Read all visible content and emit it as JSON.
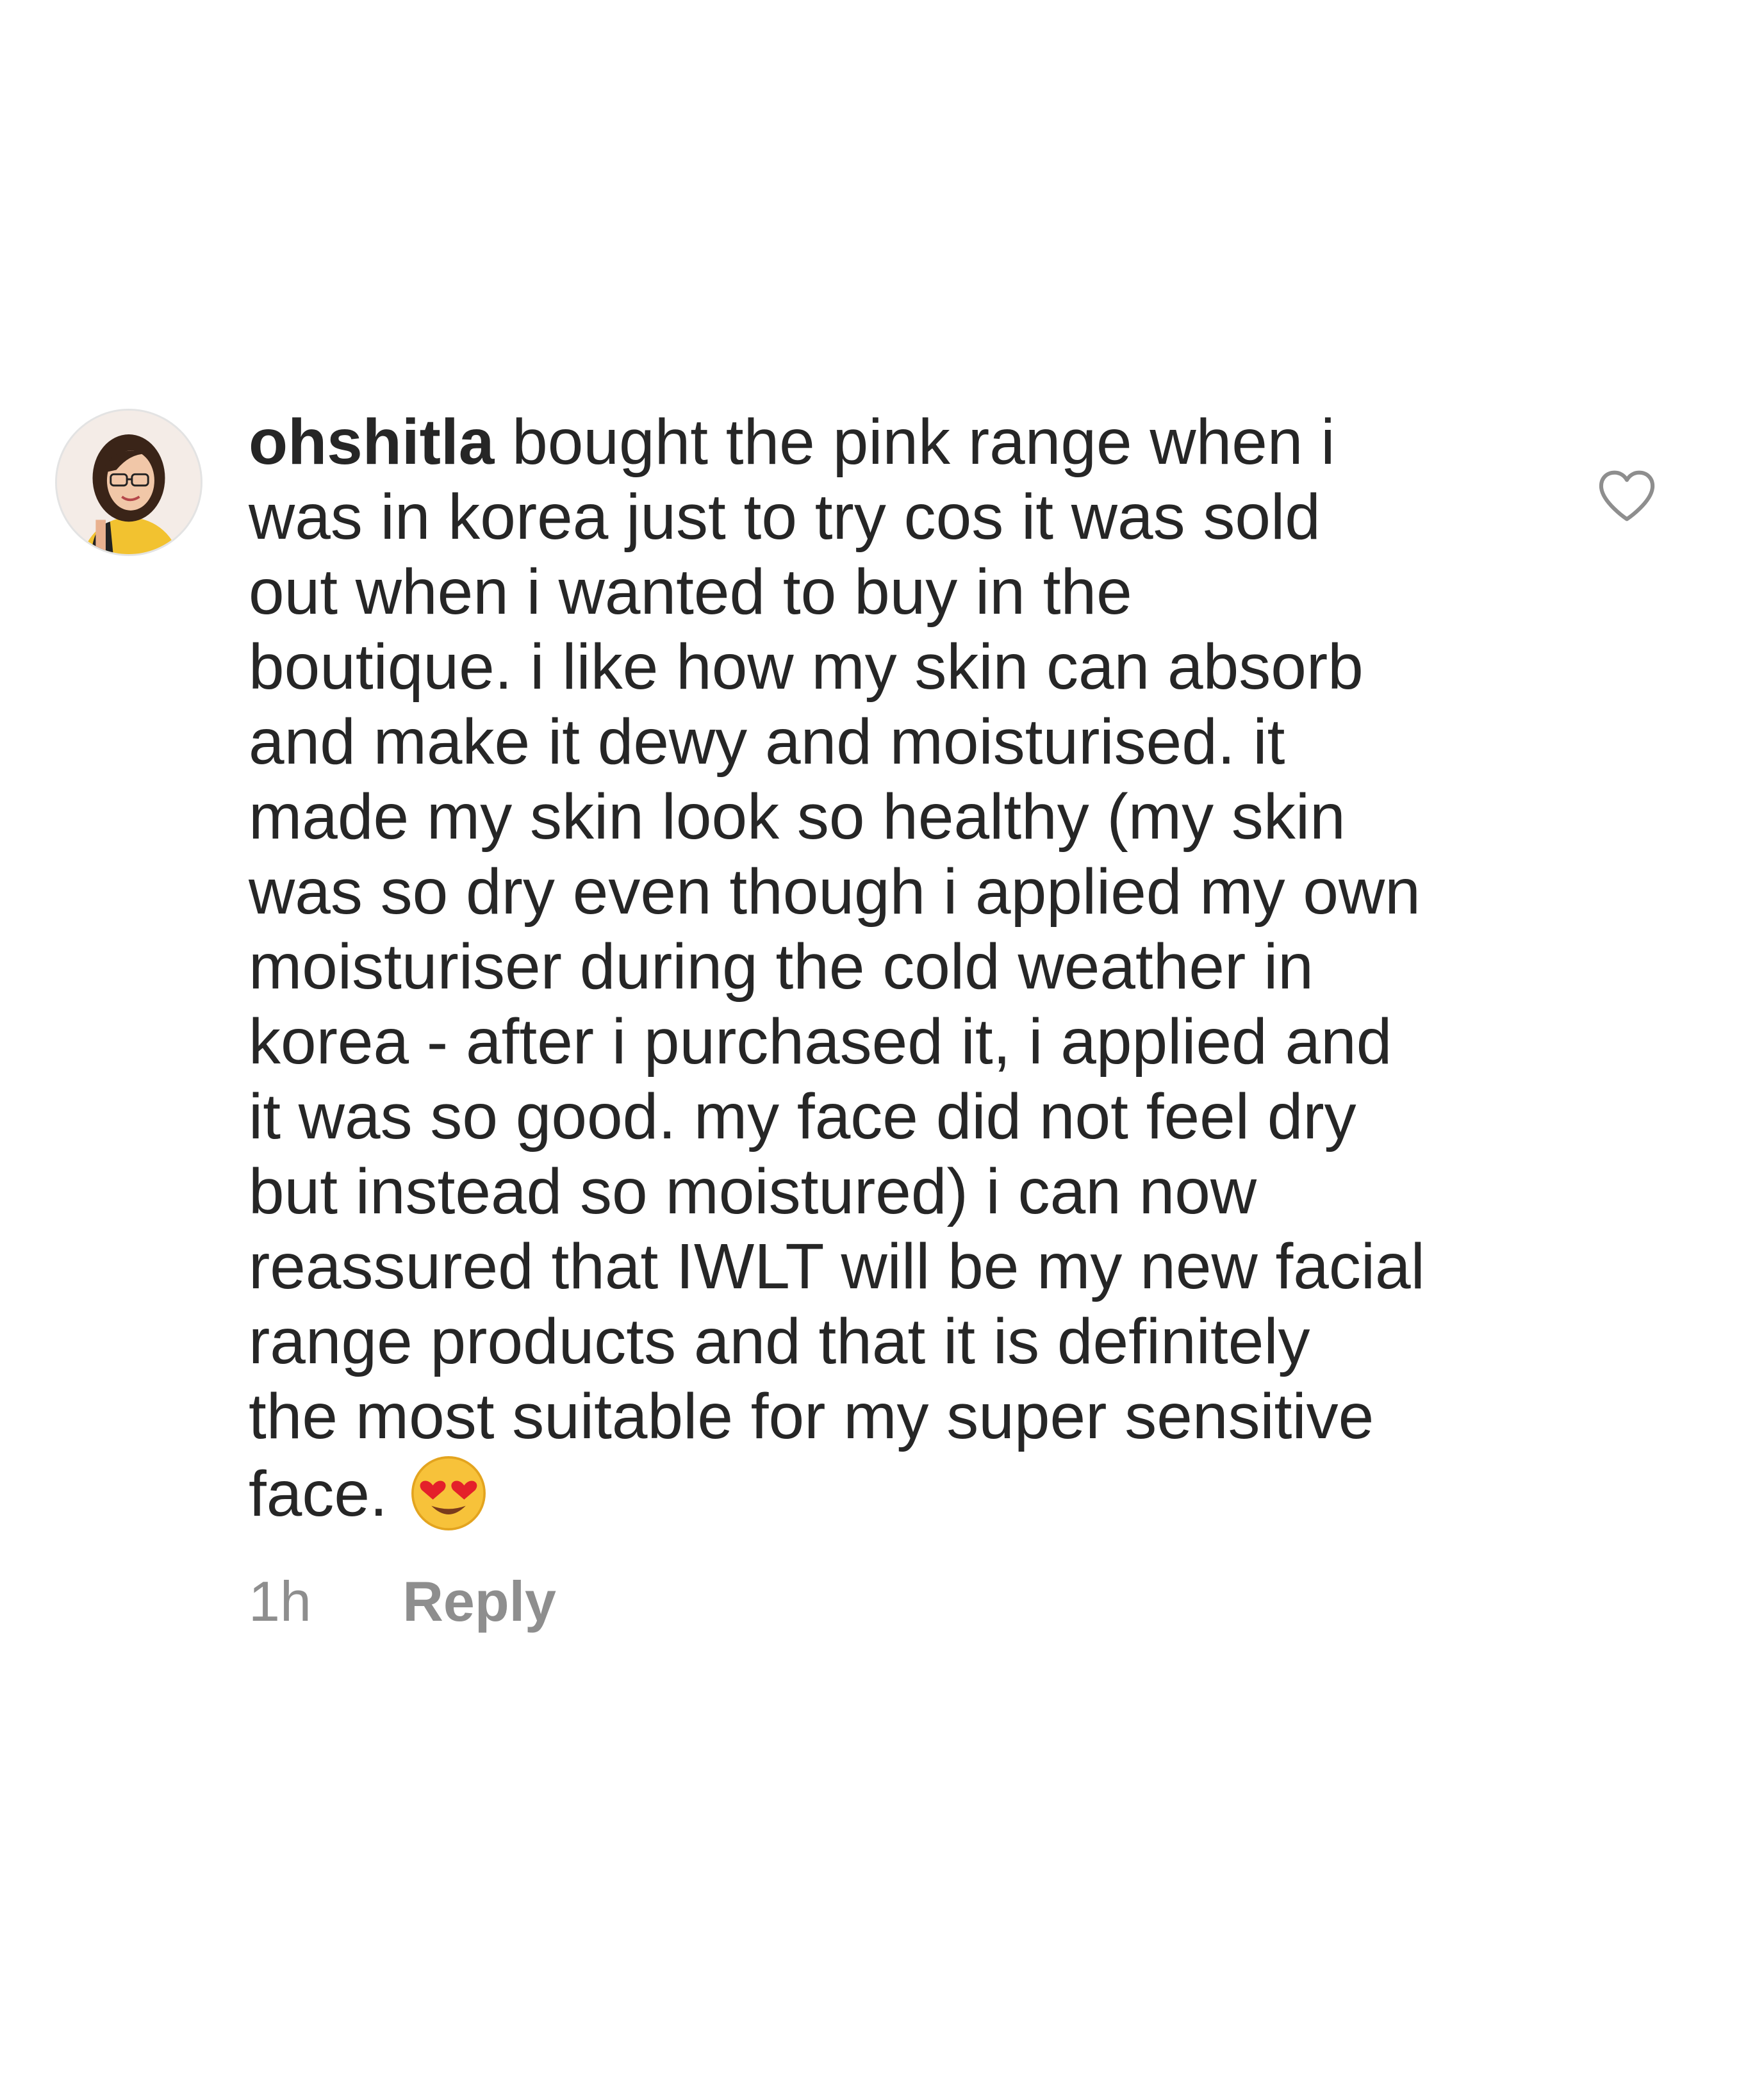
{
  "comment": {
    "username": "ohshitla",
    "lines": [
      " bought the pink range when i",
      "was in korea just to try cos it was sold",
      "out when i wanted to buy in the",
      "boutique. i like how my skin can absorb",
      "and make it dewy and moisturised. it",
      "made my skin look so healthy (my skin",
      "was so dry even though i applied my own",
      "moisturiser during the cold weather in",
      "korea - after i purchased it, i applied and",
      "it was so good. my face did not feel dry",
      "but instead so moistured) i can now",
      "reassured that IWLT will be my new facial",
      "range products and that it is definitely",
      "the most suitable for my super sensitive",
      "face."
    ],
    "emoji": "heart-eyes-emoji",
    "timestamp": "1h",
    "reply_label": "Reply"
  },
  "icons": {
    "like": "heart-outline-icon",
    "avatar": "user-avatar"
  },
  "colors": {
    "text": "#262626",
    "secondary": "#8e8e8e",
    "background": "#ffffff"
  }
}
